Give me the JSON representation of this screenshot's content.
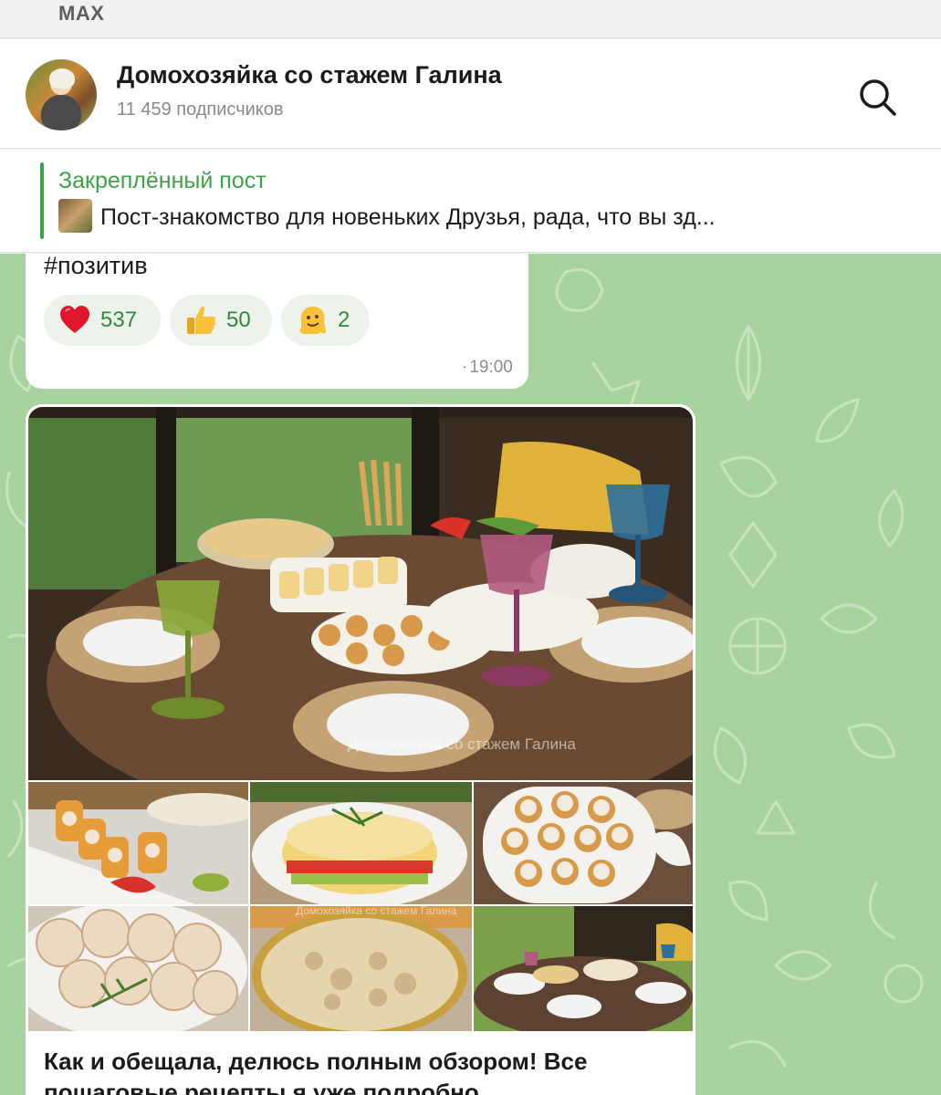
{
  "app": {
    "name": "MAX"
  },
  "channel": {
    "title": "Домохозяйка со стажем Галина",
    "subscribers": "11 459 подписчиков",
    "avatar_icon": "channel-avatar"
  },
  "header": {
    "search_icon": "search-icon"
  },
  "pinned": {
    "label": "Закреплённый пост",
    "text": "Пост-знакомство для новеньких Друзья, рада, что вы зд..."
  },
  "previous_message": {
    "hashtag": "#позитив",
    "reactions": [
      {
        "emoji": "heart-icon",
        "count": "537"
      },
      {
        "emoji": "thumbs-up-icon",
        "count": "50"
      },
      {
        "emoji": "melting-face-icon",
        "count": "2"
      }
    ],
    "time": "19:00"
  },
  "post": {
    "watermark": "Домохозяйка со стажем Галина",
    "caption_line1": "Как и обещала, делюсь полным обзором! Все",
    "caption_line2": "пошаговые рецепты я уже подробно"
  },
  "colors": {
    "accent": "#3aa547",
    "chat_background": "#a9d39e",
    "reaction_count": "#2f8a3b"
  }
}
